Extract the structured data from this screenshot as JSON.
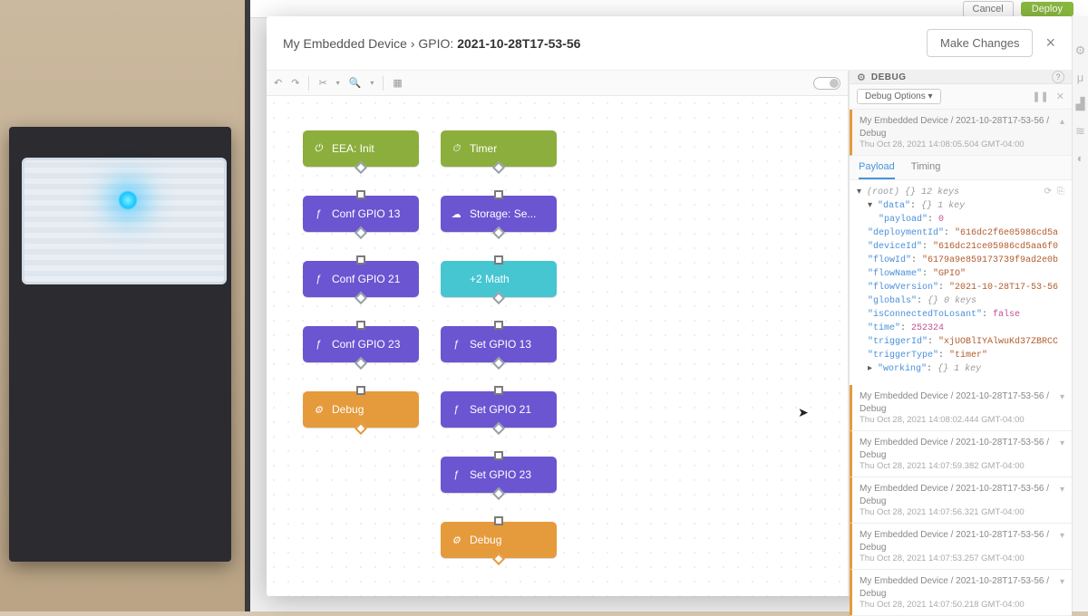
{
  "header": {
    "breadcrumb_device": "My Embedded Device",
    "breadcrumb_sep": " › ",
    "breadcrumb_section": "GPIO: ",
    "breadcrumb_version": "2021-10-28T17-53-56",
    "make_changes": "Make Changes"
  },
  "app_buttons": {
    "cancel": "Cancel",
    "deploy": "Deploy"
  },
  "toolbar": {
    "undo_icon": "↶",
    "redo_icon": "↷",
    "cut_icon": "✂",
    "zoom_icon": "🔍",
    "grid_icon": "▦"
  },
  "nodes": {
    "c1": [
      {
        "type": "olive",
        "icon": "⏻",
        "label": "EEA: Init"
      },
      {
        "type": "purple",
        "icon": "ƒ",
        "label": "Conf GPIO 13"
      },
      {
        "type": "purple",
        "icon": "ƒ",
        "label": "Conf GPIO 21"
      },
      {
        "type": "purple",
        "icon": "ƒ",
        "label": "Conf GPIO 23"
      },
      {
        "type": "orange",
        "icon": "⚙",
        "label": "Debug"
      }
    ],
    "c2": [
      {
        "type": "olive",
        "icon": "⏱",
        "label": "Timer"
      },
      {
        "type": "purple",
        "icon": "☁",
        "label": "Storage: Se..."
      },
      {
        "type": "teal",
        "icon": "",
        "label": "+2  Math"
      },
      {
        "type": "purple",
        "icon": "ƒ",
        "label": "Set GPIO 13"
      },
      {
        "type": "purple",
        "icon": "ƒ",
        "label": "Set GPIO 21"
      },
      {
        "type": "purple",
        "icon": "ƒ",
        "label": "Set GPIO 23"
      },
      {
        "type": "orange",
        "icon": "⚙",
        "label": "Debug"
      }
    ]
  },
  "debug": {
    "title": "DEBUG",
    "options_label": "Debug Options",
    "tabs": {
      "payload": "Payload",
      "timing": "Timing"
    },
    "entry_path": "My Embedded Device / 2021-10-28T17-53-56 / Debug",
    "entries": [
      {
        "ts": "Thu Oct 28, 2021 14:08:05.504 GMT-04:00",
        "open": true
      },
      {
        "ts": "Thu Oct 28, 2021 14:08:02.444 GMT-04:00"
      },
      {
        "ts": "Thu Oct 28, 2021 14:07:59.382 GMT-04:00"
      },
      {
        "ts": "Thu Oct 28, 2021 14:07:56.321 GMT-04:00"
      },
      {
        "ts": "Thu Oct 28, 2021 14:07:53.257 GMT-04:00"
      },
      {
        "ts": "Thu Oct 28, 2021 14:07:50.218 GMT-04:00"
      }
    ],
    "payload": {
      "root_note": "(root)  {}  12 keys",
      "data_note": "{}  1 key",
      "payload_val": "0",
      "deploymentId": "616dc2f6e05986cd5a",
      "deviceId": "616dc21ce05986cd5aa6f0",
      "flowId": "6179a9e859173739f9ad2e0b",
      "flowName": "GPIO",
      "flowVersion": "2021-10-28T17-53-56",
      "globals_note": "{}  0 keys",
      "isConnectedToLosant": "false",
      "time": "252324",
      "triggerId": "xjUOBlIYAlwuKd37ZBRCC",
      "triggerType": "timer",
      "working_note": "{}  1 key"
    }
  }
}
